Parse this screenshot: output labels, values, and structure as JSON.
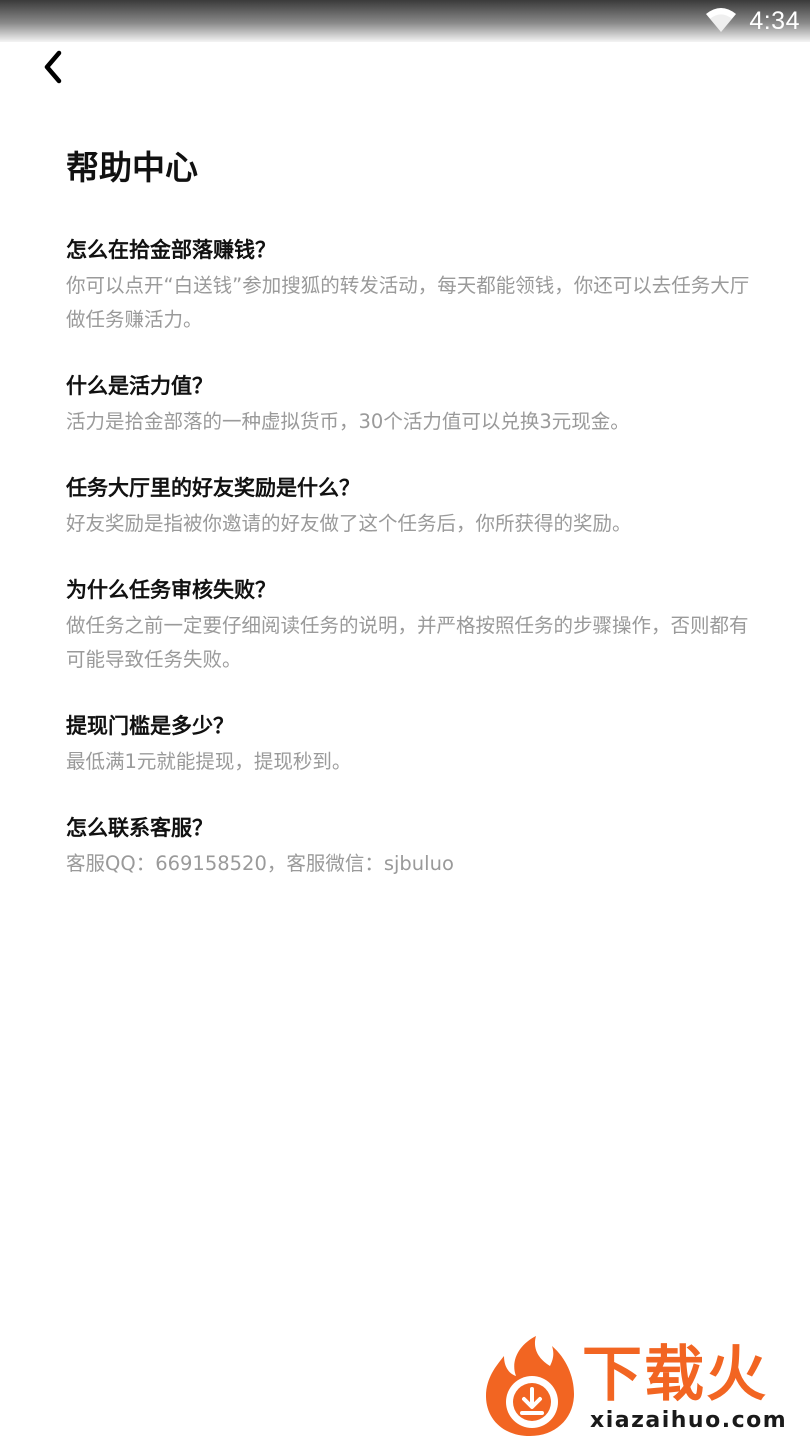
{
  "status_bar": {
    "time": "4:34",
    "icons": [
      "wifi-icon"
    ]
  },
  "header": {
    "back_icon": "chevron-left-icon",
    "title": "帮助中心"
  },
  "faq": [
    {
      "question": "怎么在拾金部落赚钱？",
      "answer": "你可以点开“白送钱”参加搜狐的转发活动，每天都能领钱，你还可以去任务大厅做任务赚活力。"
    },
    {
      "question": "什么是活力值？",
      "answer": "活力是拾金部落的一种虚拟货币，30个活力值可以兑换3元现金。"
    },
    {
      "question": "任务大厅里的好友奖励是什么？",
      "answer": "好友奖励是指被你邀请的好友做了这个任务后，你所获得的奖励。"
    },
    {
      "question": "为什么任务审核失败？",
      "answer": "做任务之前一定要仔细阅读任务的说明，并严格按照任务的步骤操作，否则都有可能导致任务失败。"
    },
    {
      "question": "提现门槛是多少？",
      "answer": "最低满1元就能提现，提现秒到。"
    },
    {
      "question": "怎么联系客服？",
      "answer": "客服QQ：669158520，客服微信：sjbuluo"
    }
  ],
  "watermark": {
    "brand": "下载火",
    "url": "xiazaihuo.com",
    "color": "#f26522"
  }
}
